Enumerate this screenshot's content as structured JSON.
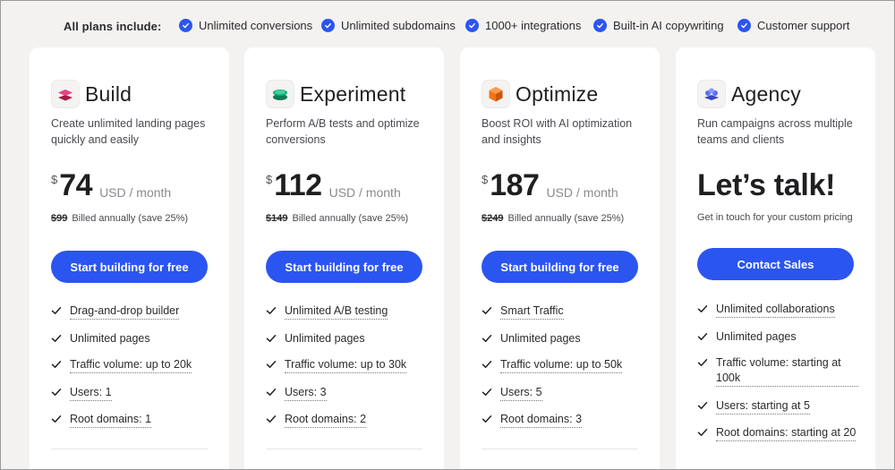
{
  "include_bar": {
    "title": "All plans include:",
    "items": [
      {
        "label": "Unlimited conversions"
      },
      {
        "label": "Unlimited subdomains"
      },
      {
        "label": "1000+ integrations"
      },
      {
        "label": "Built-in AI copywriting"
      },
      {
        "label": "Customer support"
      }
    ]
  },
  "colors": {
    "accent": "#2b55f0",
    "build_icon": "#e0336e",
    "experiment_icon": "#16b07a",
    "optimize_icon": "#f07318",
    "agency_icon": "#5b6ef0"
  },
  "plans": [
    {
      "name": "Build",
      "icon": "layers-pink-icon",
      "description": "Create unlimited landing pages quickly and easily",
      "currency": "$",
      "price": "74",
      "unit": "USD / month",
      "old_price": "$99",
      "billed": "Billed annually (save 25%)",
      "cta": "Start building for free",
      "features": [
        {
          "text": "Drag-and-drop builder",
          "dotted": true
        },
        {
          "text": "Unlimited pages",
          "dotted": false
        },
        {
          "text": "Traffic volume: up to 20k",
          "dotted": true
        },
        {
          "text": "Users: 1",
          "dotted": true
        },
        {
          "text": "Root domains: 1",
          "dotted": true
        }
      ]
    },
    {
      "name": "Experiment",
      "icon": "layers-green-icon",
      "description": "Perform A/B tests and optimize conversions",
      "currency": "$",
      "price": "112",
      "unit": "USD / month",
      "old_price": "$149",
      "billed": "Billed annually (save 25%)",
      "cta": "Start building for free",
      "features": [
        {
          "text": "Unlimited A/B testing",
          "dotted": true
        },
        {
          "text": "Unlimited pages",
          "dotted": false
        },
        {
          "text": "Traffic volume: up to 30k",
          "dotted": true
        },
        {
          "text": "Users: 3",
          "dotted": true
        },
        {
          "text": "Root domains: 2",
          "dotted": true
        }
      ]
    },
    {
      "name": "Optimize",
      "icon": "cube-orange-icon",
      "description": "Boost ROI with AI optimization and insights",
      "currency": "$",
      "price": "187",
      "unit": "USD / month",
      "old_price": "$249",
      "billed": "Billed annually (save 25%)",
      "cta": "Start building for free",
      "features": [
        {
          "text": "Smart Traffic",
          "dotted": true
        },
        {
          "text": "Unlimited pages",
          "dotted": false
        },
        {
          "text": "Traffic volume: up to 50k",
          "dotted": true
        },
        {
          "text": "Users: 5",
          "dotted": true
        },
        {
          "text": "Root domains: 3",
          "dotted": true
        }
      ]
    },
    {
      "name": "Agency",
      "icon": "layers-blue-icon",
      "description": "Run campaigns across multiple teams and clients",
      "headline": "Let’s talk!",
      "subline": "Get in touch for your custom pricing",
      "cta": "Contact Sales",
      "features": [
        {
          "text": "Unlimited collaborations",
          "dotted": true
        },
        {
          "text": "Unlimited pages",
          "dotted": false
        },
        {
          "text": "Traffic volume: starting at 100k",
          "dotted": true
        },
        {
          "text": "Users: starting at 5",
          "dotted": true
        },
        {
          "text": "Root domains: starting at 20",
          "dotted": true
        }
      ]
    }
  ]
}
